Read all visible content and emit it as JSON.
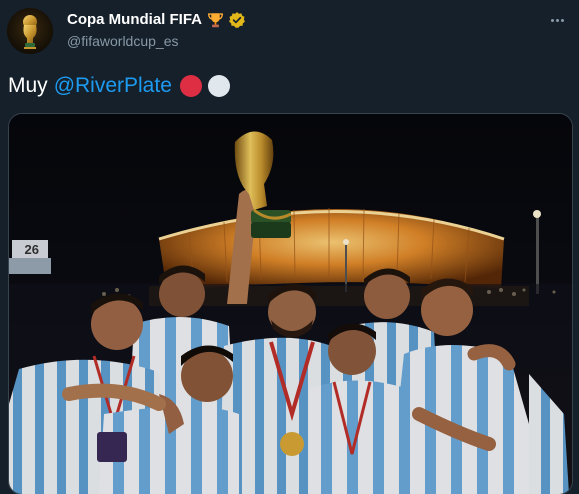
{
  "account": {
    "display_name": "Copa Mundial FIFA",
    "handle": "@fifaworldcup_es",
    "verified": true,
    "name_emoji": "trophy-icon"
  },
  "tweet": {
    "text": "Muy",
    "mention": "@RiverPlate",
    "emojis": [
      "red-circle",
      "white-circle"
    ]
  },
  "media": {
    "alt": "Jugadores de Argentina celebran con el trofeo de la Copa Mundial frente al estadio iluminado",
    "stadium_sign": "26"
  },
  "colors": {
    "background": "#15202b",
    "link": "#1d9bf0",
    "secondary_text": "#8899a6",
    "red_circle": "#dd2e44",
    "white_circle": "#e1e8ed"
  },
  "actions": {
    "more_icon": "more-icon"
  }
}
